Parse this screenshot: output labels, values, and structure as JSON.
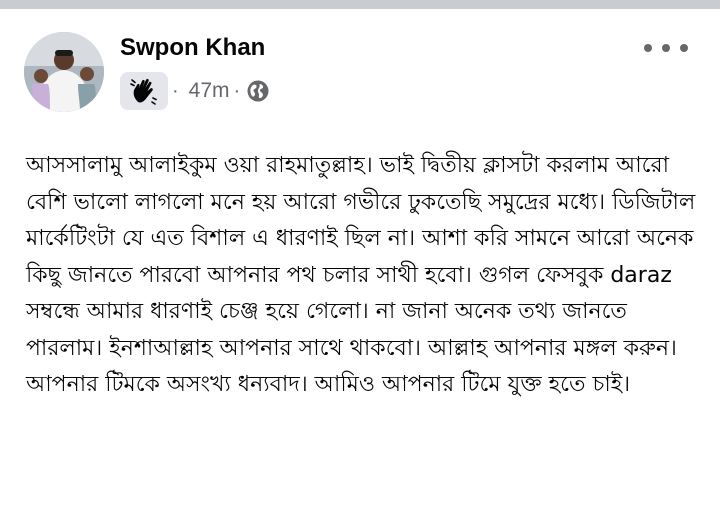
{
  "author": {
    "name": "Swpon Khan",
    "avatar_icon": "profile-photo",
    "badge_icon": "raised-hand-icon",
    "time": "47m",
    "separator": "·",
    "audience_icon": "globe-icon"
  },
  "post": {
    "text": "আসসালামু আলাইকুম ওয়া রাহমাতুল্লাহ। ভাই দ্বিতীয় ক্লাসটা করলাম আরো বেশি ভালো লাগলো মনে হয় আরো গভীরে ঢুকতেছি সমুদ্রের মধ্যে। ডিজিটাল মার্কেটিংটা যে এত বিশাল এ ধারণাই ছিল না। আশা করি সামনে আরো অনেক কিছু জানতে পারবো আপনার পথ চলার সাথী হবো। গুগল ফেসবুক daraz সম্বন্ধে আমার ধারণাই চেঞ্জ হয়ে গেলো। না জানা অনেক তথ্য জানতে পারলাম। ইনশাআল্লাহ আপনার সাথে থাকবো। আল্লাহ আপনার মঙ্গল করুন। আপনার টিমকে অসংখ্য ধন্যবাদ। আমিও আপনার টিমে যুক্ত হতে চাই।"
  },
  "menu": {
    "icon": "more-options-icon"
  },
  "colors": {
    "meta": "#65676b",
    "topbar": "#c9ccd1",
    "badge_bg": "#e4e6eb"
  }
}
